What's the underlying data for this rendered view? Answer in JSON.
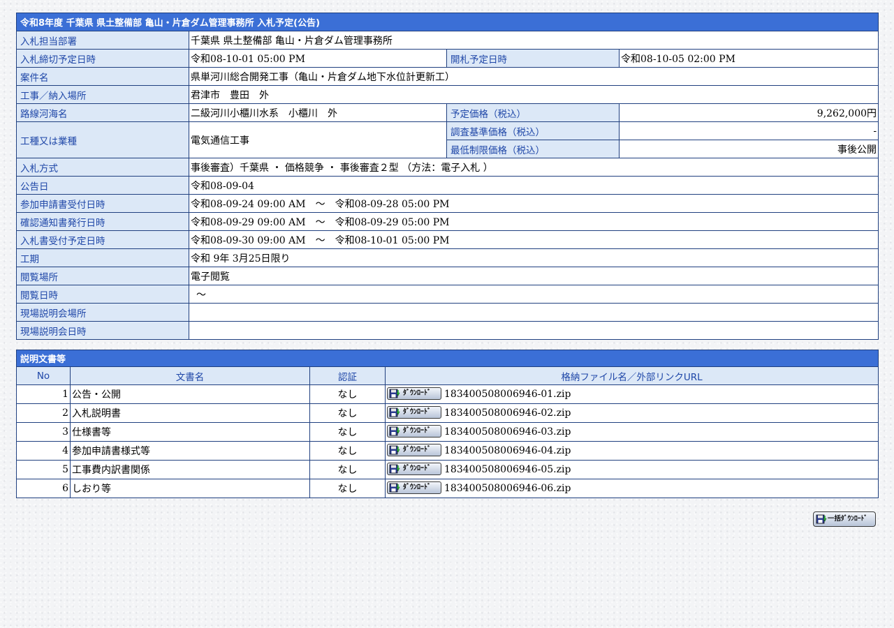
{
  "info": {
    "title": "令和8年度 千葉県 県土整備部 亀山・片倉ダム管理事務所 入札予定(公告)",
    "department_label": "入札担当部署",
    "department_value": "千葉県 県土整備部 亀山・片倉ダム管理事務所",
    "deadline_label": "入札締切予定日時",
    "deadline_value": "令和08-10-01 05:00 PM",
    "opening_label": "開札予定日時",
    "opening_value": "令和08-10-05 02:00 PM",
    "project_label": "案件名",
    "project_value": "県単河川総合開発工事（亀山・片倉ダム地下水位計更新工）",
    "location_label": "工事／納入場所",
    "location_value": "君津市　豊田　外",
    "route_label": "路線河海名",
    "route_value": "二級河川小櫃川水系　小櫃川　外",
    "planned_price_label": "予定価格（税込）",
    "planned_price_value": "9,262,000円",
    "work_type_label": "工種又は業種",
    "work_type_value": "電気通信工事",
    "survey_price_label": "調査基準価格（税込）",
    "survey_price_value": "-",
    "min_price_label": "最低制限価格（税込）",
    "min_price_value": "事後公開",
    "method_label": "入札方式",
    "method_value": "事後審査）千葉県 ・ 価格競争 ・ 事後審査２型 （方法：電子入札 ）",
    "notice_date_label": "公告日",
    "notice_date_value": "令和08-09-04",
    "application_label": "参加申請書受付日時",
    "application_value": "令和08-09-24 09:00 AM　～　令和08-09-28 05:00 PM",
    "confirmation_label": "確認通知書発行日時",
    "confirmation_value": "令和08-09-29 09:00 AM　～　令和08-09-29 05:00 PM",
    "bid_receipt_label": "入札書受付予定日時",
    "bid_receipt_value": "令和08-09-30 09:00 AM　～　令和08-10-01 05:00 PM",
    "period_label": "工期",
    "period_value": "令和 9年 3月25日限り",
    "viewing_place_label": "閲覧場所",
    "viewing_place_value": "電子閲覧",
    "viewing_date_label": "閲覧日時",
    "viewing_date_value": "～",
    "site_briefing_place_label": "現場説明会場所",
    "site_briefing_place_value": "",
    "site_briefing_date_label": "現場説明会日時",
    "site_briefing_date_value": ""
  },
  "docs": {
    "title": "説明文書等",
    "headers": [
      "No",
      "文書名",
      "認証",
      "格納ファイル名／外部リンクURL"
    ],
    "download_label": "ﾀﾞｳﾝﾛｰﾄﾞ",
    "rows": [
      {
        "no": "1",
        "name": "公告・公開",
        "auth": "なし",
        "file": "183400508006946-01.zip"
      },
      {
        "no": "2",
        "name": "入札説明書",
        "auth": "なし",
        "file": "183400508006946-02.zip"
      },
      {
        "no": "3",
        "name": "仕様書等",
        "auth": "なし",
        "file": "183400508006946-03.zip"
      },
      {
        "no": "4",
        "name": "参加申請書様式等",
        "auth": "なし",
        "file": "183400508006946-04.zip"
      },
      {
        "no": "5",
        "name": "工事費内訳書関係",
        "auth": "なし",
        "file": "183400508006946-05.zip"
      },
      {
        "no": "6",
        "name": "しおり等",
        "auth": "なし",
        "file": "183400508006946-06.zip"
      }
    ]
  },
  "bulk_download_label": "一括ﾀﾞｳﾝﾛｰﾄﾞ",
  "colors": {
    "header_bg": "#3b6fd6",
    "label_bg": "#dce8f7",
    "label_text": "#1f47a8",
    "border": "#1f3f7f"
  }
}
